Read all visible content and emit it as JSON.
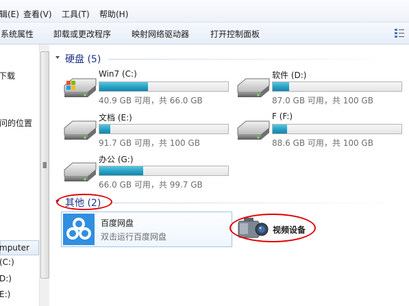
{
  "menubar": {
    "items": [
      {
        "label": "编辑(E)",
        "partial": "辑(E)"
      },
      {
        "label": "查看(V)"
      },
      {
        "label": "工具(T)"
      },
      {
        "label": "帮助(H)"
      }
    ]
  },
  "toolbar": {
    "items": [
      {
        "label": "系统属性"
      },
      {
        "label": "卸载或更改程序"
      },
      {
        "label": "映射网络驱动器"
      },
      {
        "label": "打开控制面板"
      }
    ],
    "view_icon": "view-options-icon"
  },
  "nav": {
    "items": [
      {
        "label": "下载"
      },
      {
        "label": "访问的位置",
        "partial": "问的位置"
      },
      {
        "label": "Computer",
        "partial": "mputer"
      },
      {
        "label": "(C:)"
      },
      {
        "label": "(D:)",
        "partial": "D:)"
      },
      {
        "label": "(E:)",
        "partial": "E:)"
      }
    ]
  },
  "hard_disks": {
    "header": "硬盘 (5)",
    "drives": [
      {
        "name": "Win7 (C:)",
        "info": "40.9 GB 可用，共 66.0 GB",
        "used_fraction": 0.38,
        "icon": "windows-drive-icon"
      },
      {
        "name": "软件 (D:)",
        "info": "87.0 GB 可用，共 100 GB",
        "used_fraction": 0.13,
        "icon": "hard-drive-icon"
      },
      {
        "name": "文档 (E:)",
        "info": "91.7 GB 可用，共 100 GB",
        "used_fraction": 0.083,
        "icon": "hard-drive-icon"
      },
      {
        "name": "F (F:)",
        "info": "88.6 GB 可用，共 100 GB",
        "used_fraction": 0.114,
        "icon": "hard-drive-icon"
      },
      {
        "name": "办公 (G:)",
        "info": "66.0 GB 可用，共 99.7 GB",
        "used_fraction": 0.338,
        "icon": "hard-drive-icon"
      }
    ]
  },
  "other": {
    "header": "其他 (2)",
    "items": [
      {
        "title": "百度网盘",
        "subtitle": "双击运行百度网盘",
        "icon": "baidu-netdisk-icon"
      },
      {
        "title": "视频设备",
        "icon": "video-camera-icon"
      }
    ]
  },
  "colors": {
    "header_text": "#1e3287",
    "bar_fill": "#26a0c4",
    "annotation": "#e00000",
    "baidu_blue": "#2f8fe0"
  }
}
